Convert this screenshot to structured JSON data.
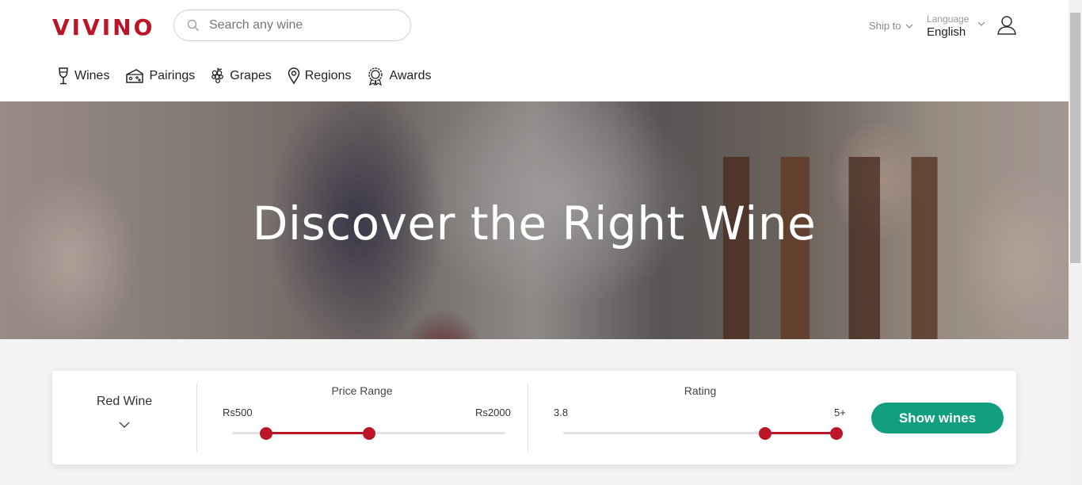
{
  "header": {
    "logo": "VIVINO",
    "search_placeholder": "Search any wine",
    "ship_to_label": "Ship to",
    "language_label": "Language",
    "language_value": "English"
  },
  "nav": {
    "items": [
      {
        "label": "Wines",
        "icon": "wine-glass-icon"
      },
      {
        "label": "Pairings",
        "icon": "cheese-icon"
      },
      {
        "label": "Grapes",
        "icon": "grapes-icon"
      },
      {
        "label": "Regions",
        "icon": "map-pin-icon"
      },
      {
        "label": "Awards",
        "icon": "award-medal-icon"
      }
    ]
  },
  "hero": {
    "title": "Discover the Right Wine"
  },
  "filters": {
    "wine_type": "Red Wine",
    "price": {
      "title": "Price Range",
      "min_label": "Rs500",
      "max_label": "Rs2000",
      "selected_low_fraction": 0.125,
      "selected_high_fraction": 0.5
    },
    "rating": {
      "title": "Rating",
      "min_label": "3.8",
      "max_label": "5+",
      "selected_low_fraction": 0.74,
      "selected_high_fraction": 1.0
    },
    "submit_label": "Show wines"
  },
  "colors": {
    "brand": "#ba1628",
    "accent_button": "#119f7f"
  }
}
